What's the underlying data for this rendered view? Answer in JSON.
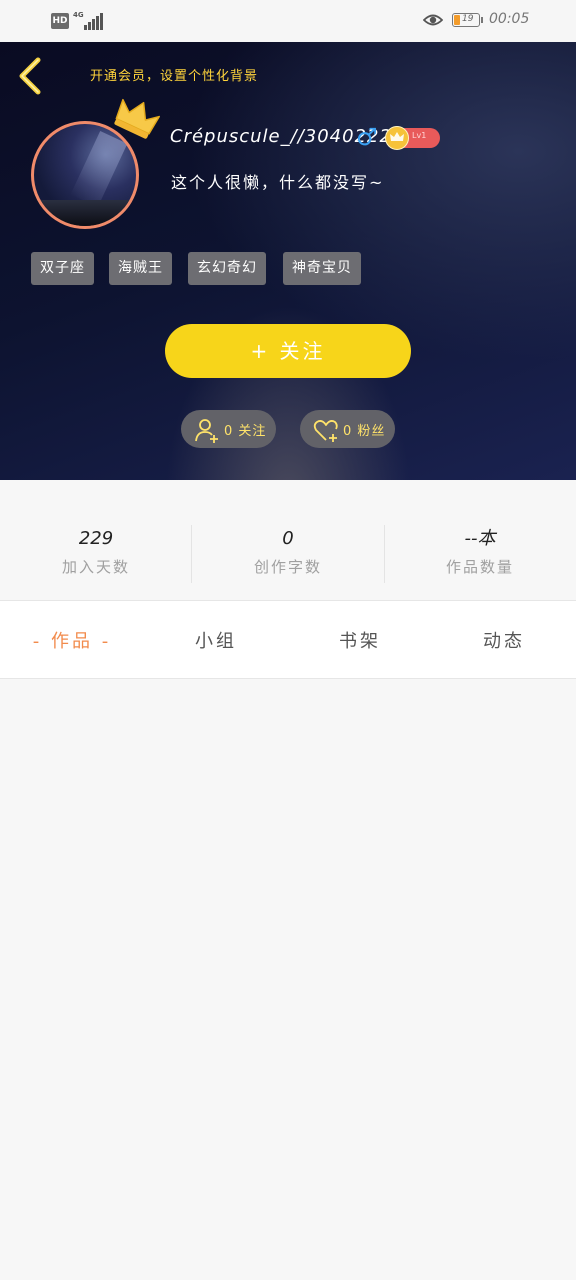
{
  "status_bar": {
    "hd": "HD",
    "network": "4G",
    "battery": "19",
    "time": "00:05"
  },
  "header": {
    "vip_link": "开通会员，设置个性化背景",
    "username": "Crépuscule_//3040222",
    "gender_symbol": "♂",
    "level": "Lv1",
    "bio": "这个人很懒，什么都没写~",
    "tags": [
      "双子座",
      "海贼王",
      "玄幻奇幻",
      "神奇宝贝"
    ],
    "follow_button": "+  关注",
    "following": "0 关注",
    "fans": "0 粉丝",
    "accent_color": "#f7d51a"
  },
  "stats": [
    {
      "value": "229",
      "label": "加入天数"
    },
    {
      "value": "0",
      "label": "创作字数"
    },
    {
      "value": "--本",
      "label": "作品数量"
    }
  ],
  "tabs": [
    {
      "label": "- 作品 -",
      "active": true
    },
    {
      "label": "小组",
      "active": false
    },
    {
      "label": "书架",
      "active": false
    },
    {
      "label": "动态",
      "active": false
    }
  ]
}
